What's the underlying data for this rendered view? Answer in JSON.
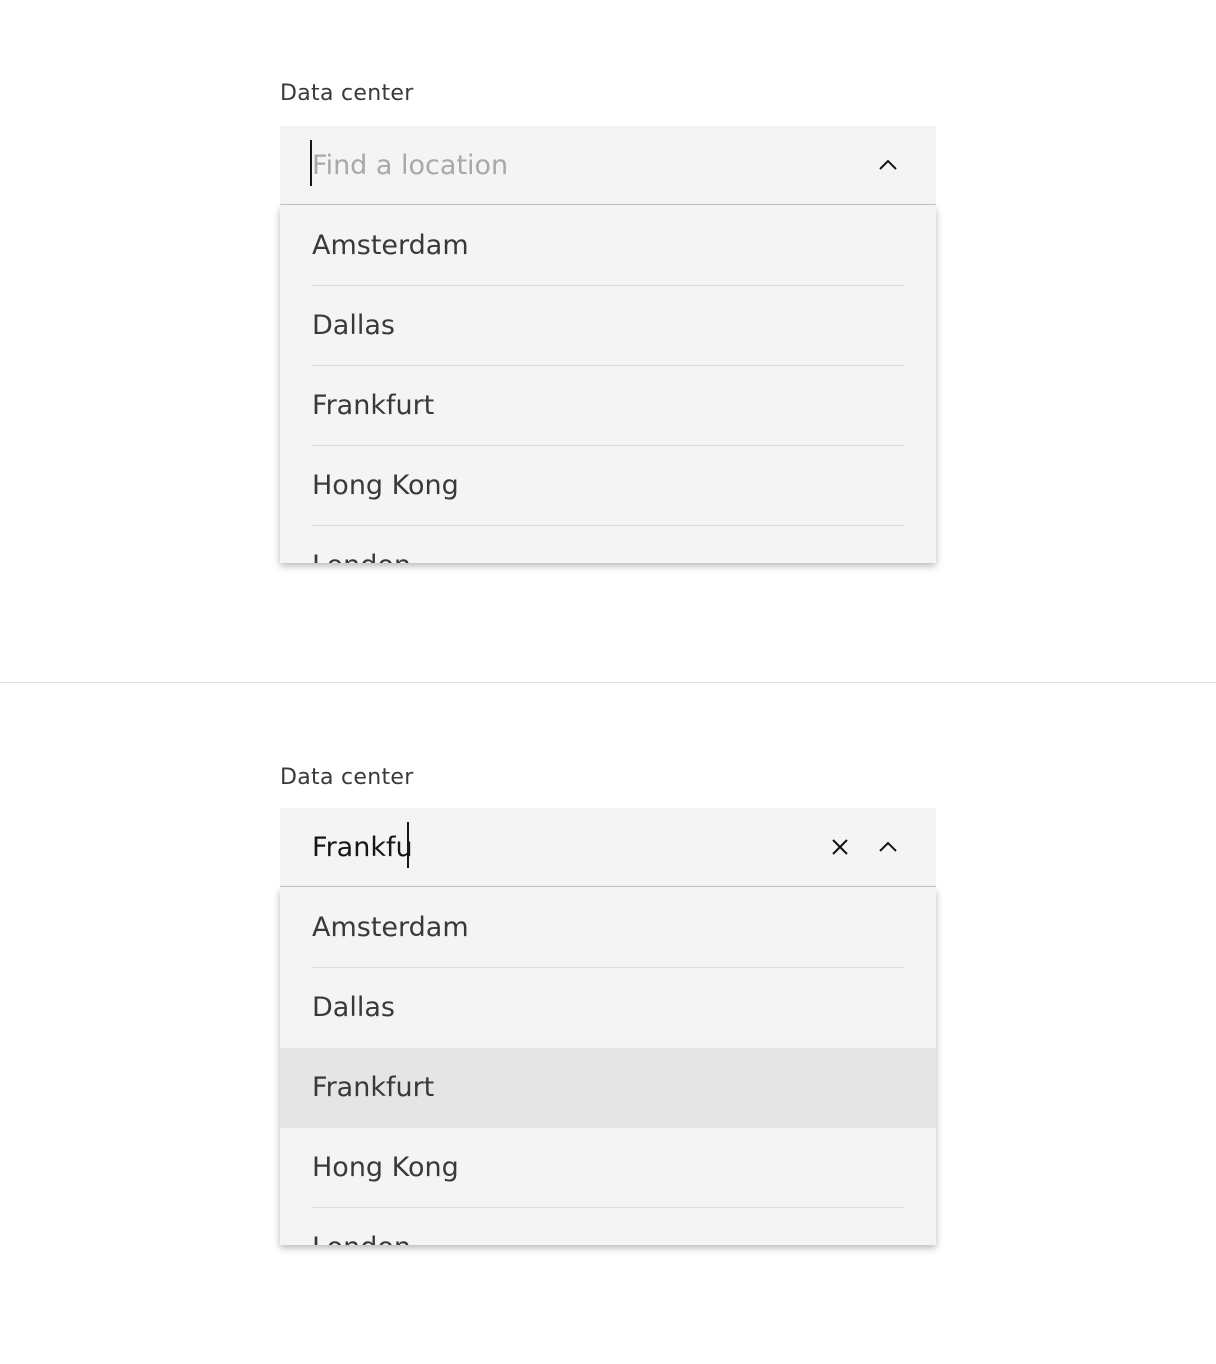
{
  "top_combobox": {
    "label": "Data center",
    "input_value": "",
    "placeholder": "Find a location",
    "toggle_icon": "chevron-up-icon",
    "options": [
      "Amsterdam",
      "Dallas",
      "Frankfurt",
      "Hong Kong",
      "London"
    ]
  },
  "bottom_combobox": {
    "label": "Data center",
    "input_value": "Frankfu",
    "placeholder": "Find a location",
    "clear_icon": "close-icon",
    "toggle_icon": "chevron-up-icon",
    "highlighted_option": "Frankfurt",
    "options": [
      "Amsterdam",
      "Dallas",
      "Frankfurt",
      "Hong Kong",
      "London"
    ]
  },
  "colors": {
    "field_background": "#f4f4f4",
    "highlight_background": "#e5e5e5",
    "text": "#393939",
    "placeholder": "#a8a8a8",
    "divider": "#e0e0e0"
  }
}
